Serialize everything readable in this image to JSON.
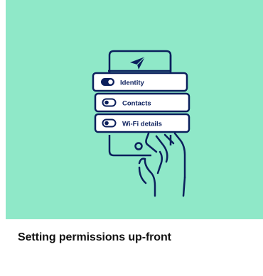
{
  "card": {
    "title": "Setting permissions up-front",
    "hero_background": "#8fe8c8",
    "illustration_color": "#0b1f5c",
    "permissions": [
      {
        "label": "Identity",
        "enabled": true
      },
      {
        "label": "Contacts",
        "enabled": false
      },
      {
        "label": "Wi-Fi details",
        "enabled": false
      }
    ],
    "icons": [
      "phone-icon",
      "paper-plane-icon",
      "hand-icon",
      "toggle-icon"
    ]
  }
}
